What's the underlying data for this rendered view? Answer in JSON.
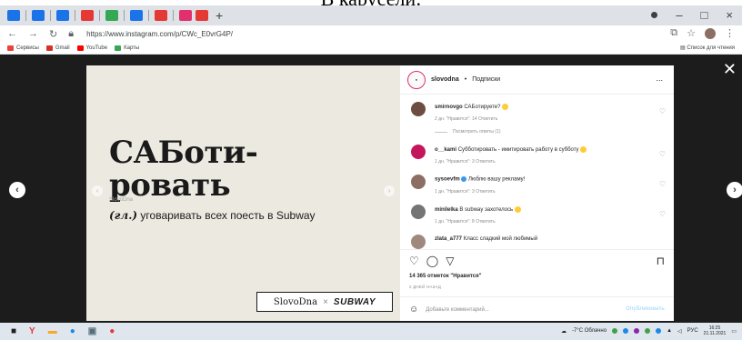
{
  "caption": "В карусели:",
  "browser": {
    "url": "https://www.instagram.com/p/CWc_E0vrG4P/",
    "new_tab": "+",
    "minimize": "–",
    "maximize": "□",
    "close": "×",
    "bookmarks": [
      "Сервисы",
      "Gmail",
      "YouTube",
      "Карты"
    ],
    "reading_list": "Список для чтения",
    "tab_colors": [
      "#1a73e8",
      "#1a73e8",
      "#1a73e8",
      "#e53935",
      "#34a853",
      "#1a73e8",
      "#e53935",
      "#e1306c",
      "#e53935"
    ]
  },
  "post": {
    "title_line1": "САБоти-",
    "title_line2": "ровать",
    "tag": "SlovoDna",
    "definition_pos": "(гл.)",
    "definition": "уговаривать всех поесть в Subway",
    "brand_slovo": "SlovoDna",
    "brand_x": "×",
    "brand_subway": "SUBWAY",
    "bg_color": "#ece9e1"
  },
  "panel": {
    "username": "slovodna",
    "separator": "•",
    "follow_label": "Подписки",
    "more": "...",
    "comments": [
      {
        "user": "smirnovgo",
        "text": "САБотируете?",
        "emoji": true,
        "meta": "2 дн.   \"Нравится\": 14   Ответить",
        "color": "#6d4c41"
      },
      {
        "user": "o__kami",
        "text": "Субботировать - имитировать работу в субботу",
        "emoji": true,
        "meta": "1 дн.   \"Нравится\": 3   Ответить",
        "color": "#c2185b"
      },
      {
        "user": "sysoevfm",
        "text": "Люблю вашу рекламу!",
        "verified": true,
        "meta": "1 дн.   \"Нравится\": 3   Ответить",
        "color": "#8d6e63"
      },
      {
        "user": "minilelka",
        "text": "В subway захотелось",
        "emoji": true,
        "meta": "1 дн.   \"Нравится\": 8   Ответить",
        "color": "#757575"
      },
      {
        "user": "zlata_a777",
        "text": "Класс сладкий мой любимый",
        "meta": "",
        "color": "#a1887f"
      }
    ],
    "show_replies": "Посмотреть ответы (1)",
    "likes": "14 365 отметок \"Нравится\"",
    "time_ago": "2 ДНЕЙ НАЗАД",
    "add_comment_placeholder": "Добавьте комментарий...",
    "publish": "Опубликовать"
  },
  "taskbar": {
    "weather": "-7°C Облачно",
    "lang": "РУС",
    "time": "16:25",
    "date": "21.11.2021"
  }
}
